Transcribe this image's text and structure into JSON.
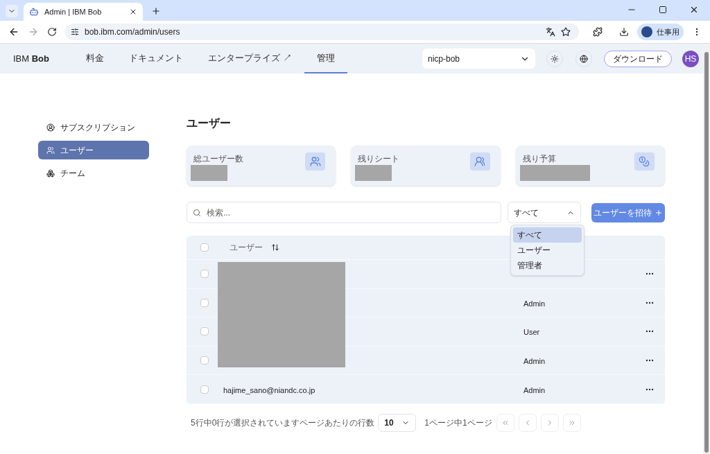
{
  "browser": {
    "tabs": [
      {
        "title": "Admin | IBM Bob",
        "selected": true
      }
    ],
    "url": "bob.ibm.com/admin/users",
    "profile_label": "仕事用"
  },
  "header": {
    "brand": "IBM **Bob**",
    "nav": [
      {
        "label": "料金",
        "selected": false
      },
      {
        "label": "ドキュメント",
        "selected": false
      },
      {
        "label": "エンタープライズ ↗",
        "selected": false
      },
      {
        "label": "管理",
        "selected": true
      }
    ],
    "workspace": "nicp-bob",
    "download": "ダウンロード",
    "avatar": "HS"
  },
  "sidebar": {
    "items": [
      {
        "label": "サブスクリプション",
        "selected": false
      },
      {
        "label": "ユーザー",
        "selected": true
      },
      {
        "label": "チーム",
        "selected": false
      }
    ]
  },
  "page_title": "ユーザー",
  "stats": [
    {
      "label": "総ユーザー数"
    },
    {
      "label": "残りシート"
    },
    {
      "label": "残り予算"
    }
  ],
  "search": {
    "placeholder": "検索..."
  },
  "filter": {
    "value": "すべて",
    "expanded": true,
    "options": [
      {
        "label": "すべて",
        "selected": true
      },
      {
        "label": "ユーザー",
        "selected": false
      },
      {
        "label": "管理者",
        "selected": false
      }
    ]
  },
  "invite_button": "ユーザーを招待",
  "table": {
    "all_checked": false,
    "columns": [
      "ユーザー"
    ],
    "rows": [
      {
        "checked": false
      },
      {
        "role": "Admin",
        "checked": false
      },
      {
        "role": "User",
        "checked": false
      },
      {
        "role": "Admin",
        "checked": false
      },
      {
        "user": "hajime_sano@niandc.co.jp",
        "role": "Admin",
        "checked": false
      }
    ]
  },
  "footer": {
    "selection": "5行中0行が選択されています",
    "rows_per_page_label": "ページあたりの行数",
    "page_size": "10",
    "page_info": "1ページ中1ページ"
  }
}
